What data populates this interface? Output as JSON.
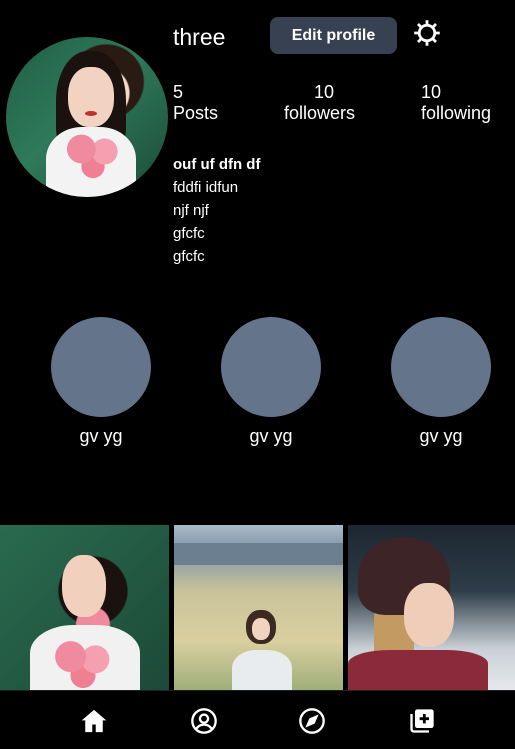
{
  "profile": {
    "username": "three",
    "edit_label": "Edit profile",
    "settings_icon": "gear-icon",
    "photo_alt": "profile-photo"
  },
  "stats": {
    "posts": {
      "count": "5",
      "label": "Posts"
    },
    "followers": {
      "count": "10",
      "label": "followers"
    },
    "following": {
      "count": "10",
      "label": "following"
    }
  },
  "bio": {
    "name": "ouf uf dfn df",
    "lines": [
      "fddfi idfun",
      "njf njf",
      "gfcfc",
      "gfcfc"
    ]
  },
  "highlights": [
    {
      "label": "gv yg"
    },
    {
      "label": "gv yg"
    },
    {
      "label": "gv yg"
    }
  ],
  "nav": {
    "items": [
      "home-icon",
      "profile-icon",
      "compass-icon",
      "add-post-icon"
    ]
  },
  "colors": {
    "background": "#000000",
    "button": "#374151",
    "highlight_circle": "#64748b"
  }
}
